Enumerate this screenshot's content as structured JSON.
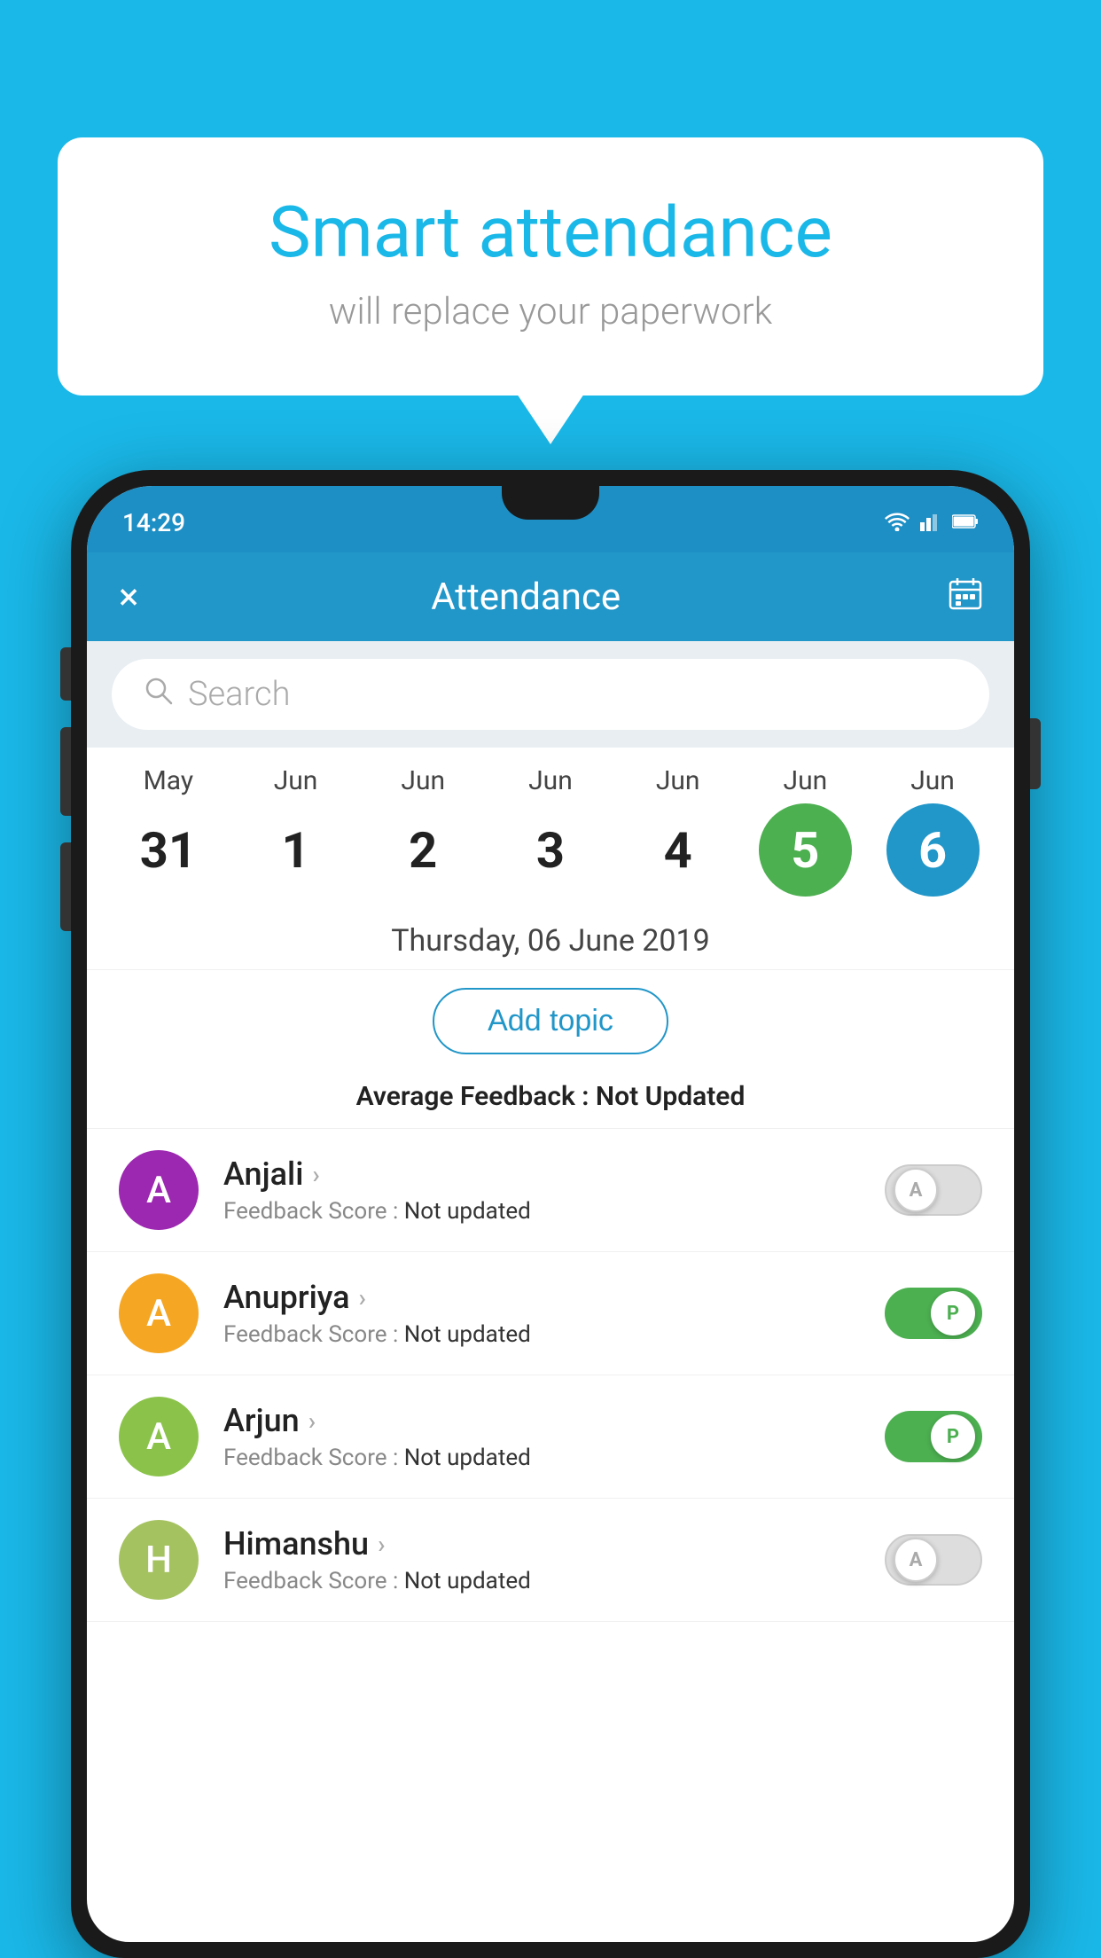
{
  "background_color": "#1ab8e8",
  "bubble": {
    "title": "Smart attendance",
    "subtitle": "will replace your paperwork"
  },
  "status_bar": {
    "time": "14:29",
    "wifi": "▾",
    "signal": "▲",
    "battery": "▮"
  },
  "header": {
    "title": "Attendance",
    "close_label": "×",
    "calendar_label": "📅"
  },
  "search": {
    "placeholder": "Search"
  },
  "calendar": {
    "days": [
      {
        "month": "May",
        "date": "31",
        "style": "normal"
      },
      {
        "month": "Jun",
        "date": "1",
        "style": "normal"
      },
      {
        "month": "Jun",
        "date": "2",
        "style": "normal"
      },
      {
        "month": "Jun",
        "date": "3",
        "style": "normal"
      },
      {
        "month": "Jun",
        "date": "4",
        "style": "normal"
      },
      {
        "month": "Jun",
        "date": "5",
        "style": "today"
      },
      {
        "month": "Jun",
        "date": "6",
        "style": "selected"
      }
    ]
  },
  "selected_date": "Thursday, 06 June 2019",
  "add_topic_label": "Add topic",
  "avg_feedback": {
    "label": "Average Feedback : ",
    "value": "Not Updated"
  },
  "students": [
    {
      "name": "Anjali",
      "feedback": "Not updated",
      "avatar_letter": "A",
      "avatar_color": "#9c27b0",
      "toggle_state": "off",
      "toggle_label": "A"
    },
    {
      "name": "Anupriya",
      "feedback": "Not updated",
      "avatar_letter": "A",
      "avatar_color": "#f5a623",
      "toggle_state": "on",
      "toggle_label": "P"
    },
    {
      "name": "Arjun",
      "feedback": "Not updated",
      "avatar_letter": "A",
      "avatar_color": "#8bc34a",
      "toggle_state": "on",
      "toggle_label": "P"
    },
    {
      "name": "Himanshu",
      "feedback": "Not updated",
      "avatar_letter": "H",
      "avatar_color": "#a5c261",
      "toggle_state": "off",
      "toggle_label": "A"
    }
  ]
}
